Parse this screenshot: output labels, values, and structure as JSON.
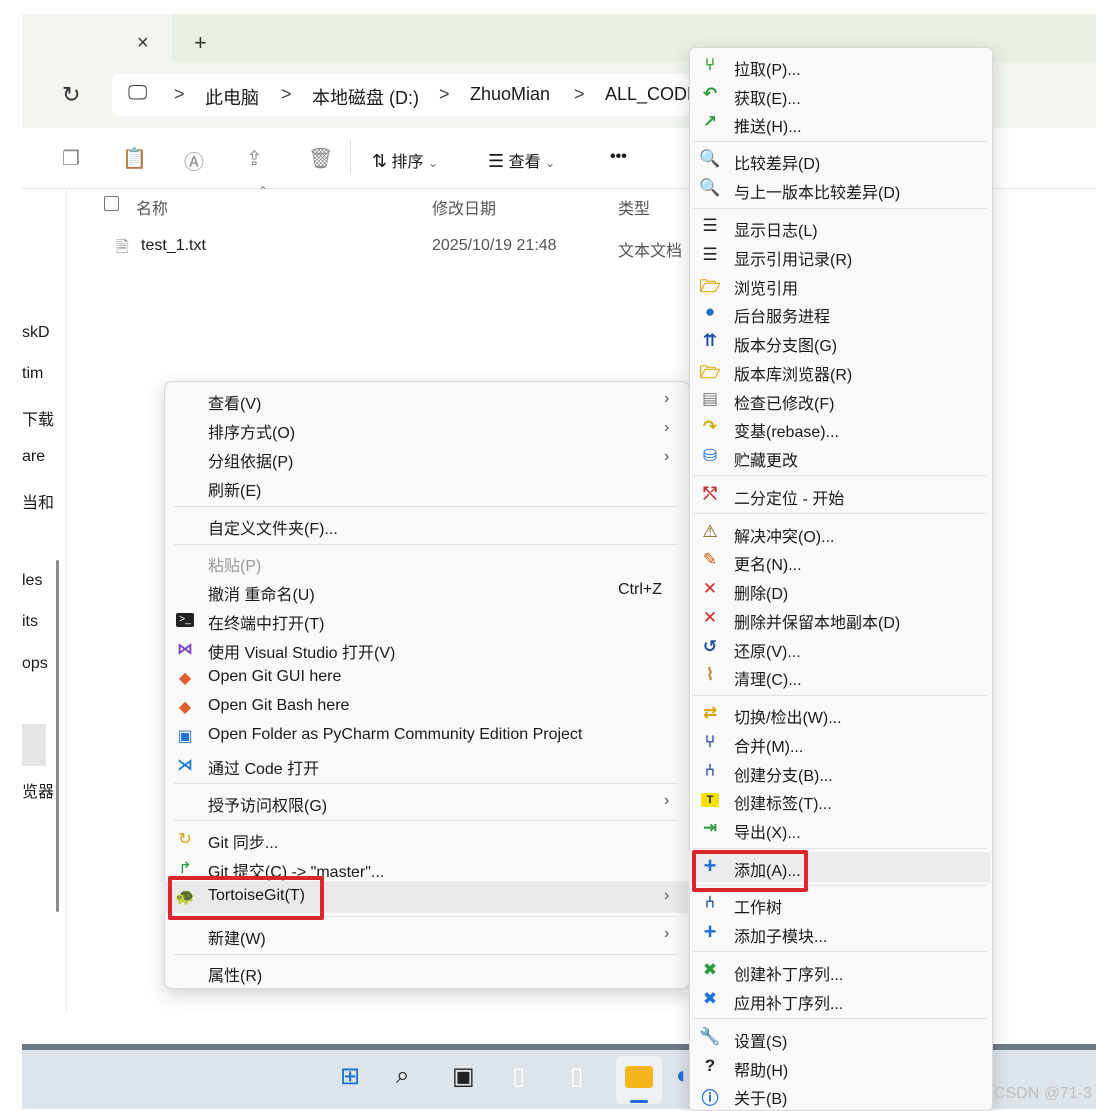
{
  "tabbar": {
    "close_glyph": "×",
    "new_tab_glyph": "+"
  },
  "address": {
    "crumbs": [
      "此电脑",
      "本地磁盘 (D:)",
      "ZhuoMian",
      "ALL_CODE"
    ],
    "sep": ">"
  },
  "toolbar": {
    "sort_label": "排序",
    "view_label": "查看",
    "more_label": "•••",
    "dropdown_glyph": "⌄"
  },
  "sidebar": [
    "skD",
    "tim",
    "下载",
    "are",
    "当和",
    "les",
    "its",
    "ops",
    "览器"
  ],
  "columns": {
    "name": "名称",
    "date": "修改日期",
    "type": "类型"
  },
  "files": [
    {
      "name": "test_1.txt",
      "date": "2025/10/19 21:48",
      "type": "文本文档"
    }
  ],
  "context_menu": {
    "items": [
      {
        "label": "查看(V)",
        "submenu": true
      },
      {
        "label": "排序方式(O)",
        "submenu": true
      },
      {
        "label": "分组依据(P)",
        "submenu": true
      },
      {
        "label": "刷新(E)"
      },
      {
        "label": "自定义文件夹(F)..."
      },
      {
        "label": "粘贴(P)",
        "disabled": true
      },
      {
        "label": "撤消 重命名(U)",
        "shortcut": "Ctrl+Z"
      },
      {
        "label": "在终端中打开(T)",
        "icon": "terminal-icon"
      },
      {
        "label": "使用 Visual Studio 打开(V)",
        "icon": "visual-studio-icon"
      },
      {
        "label": "Open Git GUI here",
        "icon": "git-gui-icon"
      },
      {
        "label": "Open Git Bash here",
        "icon": "git-bash-icon"
      },
      {
        "label": "Open Folder as PyCharm Community Edition Project",
        "icon": "pycharm-icon"
      },
      {
        "label": "通过 Code 打开",
        "icon": "vscode-icon"
      },
      {
        "label": "授予访问权限(G)",
        "submenu": true
      },
      {
        "label": "Git 同步...",
        "icon": "git-sync-icon"
      },
      {
        "label": "Git 提交(C) -> \"master\"...",
        "icon": "git-commit-icon"
      },
      {
        "label": "TortoiseGit(T)",
        "icon": "tortoisegit-icon",
        "submenu": true
      },
      {
        "label": "新建(W)",
        "submenu": true
      },
      {
        "label": "属性(R)"
      }
    ],
    "arrow_glyph": "›"
  },
  "tortoise_menu": {
    "items": [
      {
        "label": "拉取(P)...",
        "icon": "pull-icon"
      },
      {
        "label": "获取(E)...",
        "icon": "fetch-icon"
      },
      {
        "label": "推送(H)...",
        "icon": "push-icon"
      },
      {
        "label": "比较差异(D)",
        "icon": "diff-icon"
      },
      {
        "label": "与上一版本比较差异(D)",
        "icon": "diff-previous-icon"
      },
      {
        "label": "显示日志(L)",
        "icon": "log-icon"
      },
      {
        "label": "显示引用记录(R)",
        "icon": "reflog-icon"
      },
      {
        "label": "浏览引用",
        "icon": "browse-refs-icon"
      },
      {
        "label": "后台服务进程",
        "icon": "daemon-icon"
      },
      {
        "label": "版本分支图(G)",
        "icon": "revision-graph-icon"
      },
      {
        "label": "版本库浏览器(R)",
        "icon": "repo-browser-icon"
      },
      {
        "label": "检查已修改(F)",
        "icon": "check-modifications-icon"
      },
      {
        "label": "变基(rebase)...",
        "icon": "rebase-icon"
      },
      {
        "label": "贮藏更改",
        "icon": "stash-icon"
      },
      {
        "label": "二分定位 - 开始",
        "icon": "bisect-icon"
      },
      {
        "label": "解决冲突(O)...",
        "icon": "resolve-icon"
      },
      {
        "label": "更名(N)...",
        "icon": "rename-icon"
      },
      {
        "label": "删除(D)",
        "icon": "delete-icon"
      },
      {
        "label": "删除并保留本地副本(D)",
        "icon": "delete-keep-icon"
      },
      {
        "label": "还原(V)...",
        "icon": "revert-icon"
      },
      {
        "label": "清理(C)...",
        "icon": "cleanup-icon"
      },
      {
        "label": "切换/检出(W)...",
        "icon": "switch-icon"
      },
      {
        "label": "合并(M)...",
        "icon": "merge-icon"
      },
      {
        "label": "创建分支(B)...",
        "icon": "branch-icon"
      },
      {
        "label": "创建标签(T)...",
        "icon": "tag-icon"
      },
      {
        "label": "导出(X)...",
        "icon": "export-icon"
      },
      {
        "label": "添加(A)...",
        "icon": "add-icon"
      },
      {
        "label": "工作树",
        "icon": "worktree-icon"
      },
      {
        "label": "添加子模块...",
        "icon": "add-submodule-icon"
      },
      {
        "label": "创建补丁序列...",
        "icon": "create-patch-icon"
      },
      {
        "label": "应用补丁序列...",
        "icon": "apply-patch-icon"
      },
      {
        "label": "设置(S)",
        "icon": "settings-icon"
      },
      {
        "label": "帮助(H)",
        "icon": "help-icon"
      },
      {
        "label": "关于(B)",
        "icon": "about-icon"
      }
    ]
  },
  "watermark": "CSDN @71-3",
  "colors": {
    "highlight_box": "#d9262c",
    "menu_bg": "#f9f9f9",
    "tab_bg": "#e8efe3"
  }
}
